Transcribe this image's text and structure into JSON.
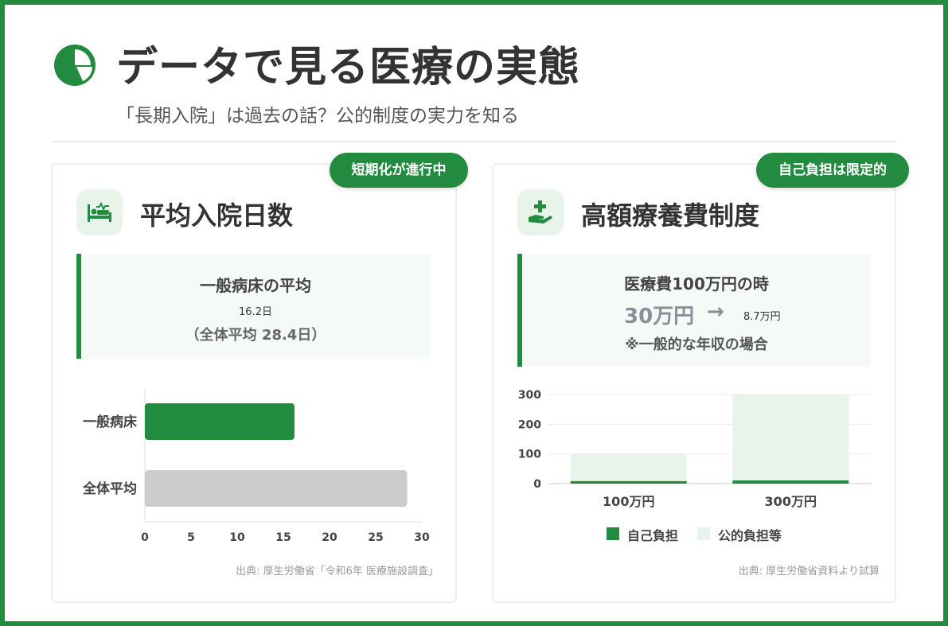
{
  "header": {
    "title": "データで見る医療の実態",
    "subtitle": "「長期入院」は過去の話？公的制度の実力を知る",
    "icon": "pie-chart-icon"
  },
  "colors": {
    "brand": "#228b3f",
    "light": "#e8f4ea",
    "gray_bar": "#cccccc"
  },
  "left_card": {
    "badge": "短期化が進行中",
    "icon": "hospital-bed-icon",
    "title": "平均入院日数",
    "info": {
      "head": "一般病床の平均",
      "value": "16.2日",
      "sub": "（全体平均 28.4日）"
    },
    "source": "出典: 厚生労働省「令和6年 医療施設調査」"
  },
  "right_card": {
    "badge": "自己負担は限定的",
    "icon": "hand-plus-icon",
    "title": "高額療養費制度",
    "info": {
      "head": "医療費100万円の時",
      "from": "30万円",
      "arrow": "→",
      "to": "8.7万円",
      "note": "※一般的な年収の場合"
    },
    "source": "出典: 厚生労働省資料より試算"
  },
  "chart_data": [
    {
      "type": "bar",
      "orientation": "horizontal",
      "categories": [
        "一般病床",
        "全体平均"
      ],
      "values": [
        16.2,
        28.4
      ],
      "xlim": [
        0,
        30
      ],
      "xticks": [
        "0",
        "5",
        "10",
        "15",
        "20",
        "25",
        "30"
      ],
      "title": "",
      "xlabel": "",
      "ylabel": "",
      "colors": [
        "#228b3f",
        "#cccccc"
      ],
      "grid": false
    },
    {
      "type": "bar",
      "orientation": "vertical",
      "stacked": true,
      "categories": [
        "100万円",
        "300万円"
      ],
      "series": [
        {
          "name": "自己負担",
          "values": [
            8.7,
            11.0
          ],
          "color": "#228b3f"
        },
        {
          "name": "公的負担等",
          "values": [
            91.3,
            289.0
          ],
          "color": "#e8f4ea"
        }
      ],
      "ylim": [
        0,
        300
      ],
      "yticks": [
        "0",
        "100",
        "200",
        "300"
      ],
      "title": "",
      "xlabel": "",
      "ylabel": "",
      "grid": true,
      "legend": "bottom"
    }
  ]
}
